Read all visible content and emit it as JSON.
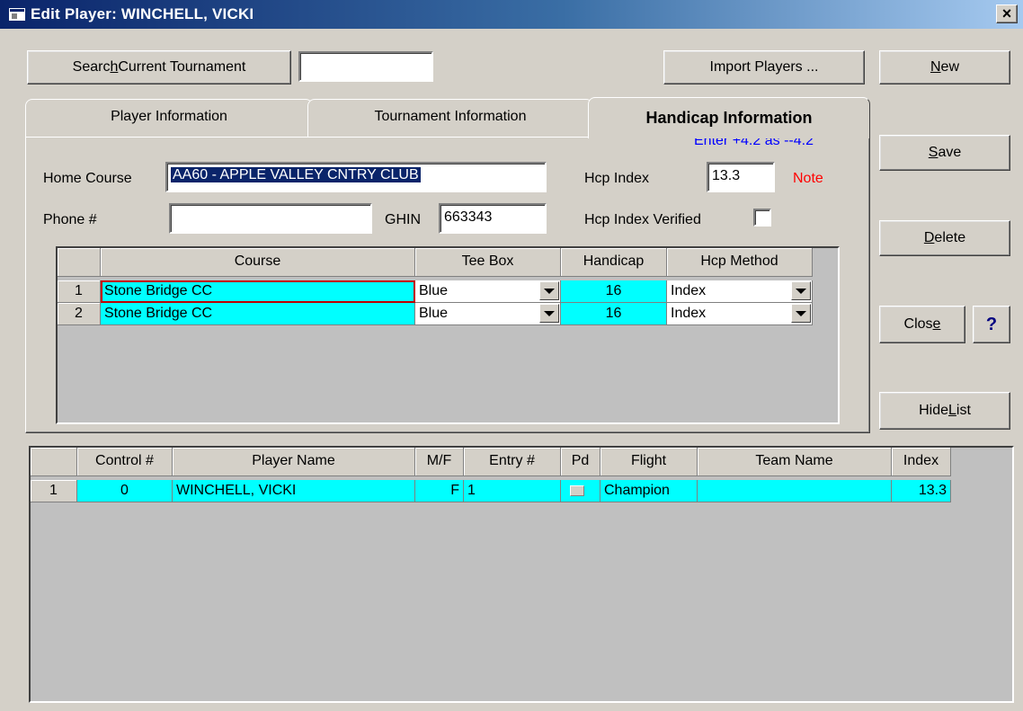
{
  "window": {
    "title": "Edit Player: WINCHELL, VICKI",
    "close_glyph": "×"
  },
  "toolbar": {
    "search_label_pre": "Searc",
    "search_label_mnemonic": "h",
    "search_label_post": " Current Tournament",
    "search_value": "",
    "import_label": "Import Players ..."
  },
  "side_buttons": {
    "new_mn": "N",
    "new_rest": "ew",
    "save_mn": "S",
    "save_rest": "ave",
    "delete_mn": "D",
    "delete_rest": "elete",
    "close_pre": "Clos",
    "close_mn": "e",
    "help": "?",
    "hide_pre": "Hide ",
    "hide_mn": "L",
    "hide_rest": "ist"
  },
  "tabs": [
    "Player Information",
    "Tournament Information",
    "Handicap Information"
  ],
  "handicap": {
    "hint": "Enter +4.2 as --4.2",
    "home_course_label": "Home Course",
    "home_course_value": "AA60 - APPLE VALLEY CNTRY CLUB",
    "hcp_index_label": "Hcp Index",
    "hcp_index_value": "13.3",
    "note": "Note",
    "phone_label": "Phone #",
    "phone_value": "",
    "ghin_label": "GHIN",
    "ghin_value": "663343",
    "verified_label": "Hcp Index Verified"
  },
  "course_grid": {
    "headers": [
      "Course",
      "Tee Box",
      "Handicap",
      "Hcp Method"
    ],
    "rows": [
      {
        "num": "1",
        "course": "Stone Bridge CC",
        "tee": "Blue",
        "handicap": "16",
        "method": "Index"
      },
      {
        "num": "2",
        "course": "Stone Bridge CC",
        "tee": "Blue",
        "handicap": "16",
        "method": "Index"
      }
    ]
  },
  "player_list": {
    "headers": [
      "Control #",
      "Player Name",
      "M/F",
      "Entry #",
      "Pd",
      "Flight",
      "Team Name",
      "Index"
    ],
    "rows": [
      {
        "num": "1",
        "control": "0",
        "name": "WINCHELL, VICKI",
        "mf": "F",
        "entry": "1",
        "flight": "Champion",
        "team": "",
        "index": "13.3"
      }
    ]
  },
  "colors": {
    "selected_row": "#00ffff",
    "hint": "#0000ff",
    "note": "#ff0000",
    "titlebar": "#0a246a"
  }
}
